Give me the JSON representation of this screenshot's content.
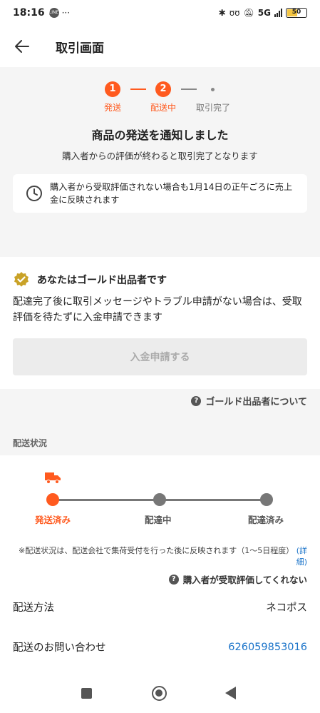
{
  "status_bar": {
    "time": "18:16",
    "dots": "···",
    "line_badge": "LINE",
    "network": "5G",
    "battery": "50"
  },
  "header": {
    "title": "取引画面"
  },
  "progress": {
    "steps": [
      {
        "number": "1",
        "label": "発送",
        "state": "done"
      },
      {
        "number": "2",
        "label": "配送中",
        "state": "current"
      },
      {
        "number": "",
        "label": "取引完了",
        "state": "pending"
      }
    ],
    "accent_color": "#ff5a1f"
  },
  "notice": {
    "title": "商品の発送を通知しました",
    "subtitle": "購入者からの評価が終わると取引完了となります",
    "info_text": "購入者から受取評価されない場合も1月14日の正午ごろに売上金に反映されます"
  },
  "gold": {
    "title": "あなたはゴールド出品者です",
    "description": "配達完了後に取引メッセージやトラブル申請がない場合は、受取評価を待たずに入金申請できます",
    "button_label": "入金申請する",
    "about_link": "ゴールド出品者について"
  },
  "delivery": {
    "section_label": "配送状況",
    "track": [
      {
        "label": "発送済み",
        "state": "done"
      },
      {
        "label": "配達中",
        "state": "pending"
      },
      {
        "label": "配達済み",
        "state": "pending"
      }
    ],
    "note": "※配送状況は、配送会社で集荷受付を行った後に反映されます（1〜5日程度）",
    "detail_link": "(詳細)",
    "buyer_help_link": "購入者が受取評価してくれない",
    "method_label": "配送方法",
    "method_value": "ネコポス",
    "inquiry_label": "配送のお問い合わせ",
    "inquiry_value": "626059853016"
  },
  "icons": {
    "back": "back-arrow-icon",
    "clock": "clock-icon",
    "gold_badge": "gold-badge-icon",
    "help": "question-circle-icon",
    "truck": "truck-icon"
  }
}
